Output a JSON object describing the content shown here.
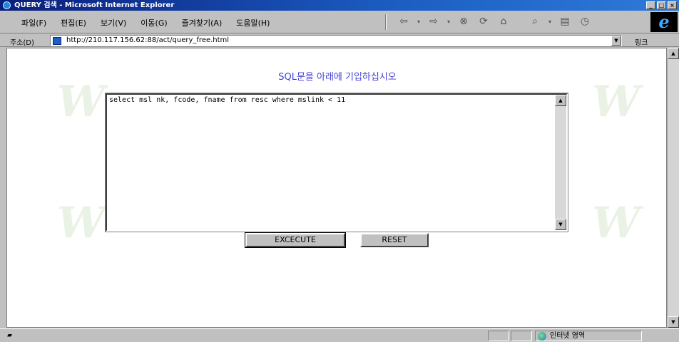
{
  "window": {
    "title": "QUERY 검색 - Microsoft Internet Explorer",
    "controls": [
      "_",
      "□",
      "×"
    ]
  },
  "menu": {
    "items": [
      "파일(F)",
      "편집(E)",
      "보기(V)",
      "이동(G)",
      "즐겨찾기(A)",
      "도움말(H)"
    ]
  },
  "toolbar": {
    "icons": [
      "back-icon",
      "forward-icon",
      "stop-icon",
      "refresh-icon",
      "home-icon",
      "search-icon",
      "favorites-icon",
      "history-icon"
    ]
  },
  "address": {
    "label": "주소(D)",
    "url": "http://210.117.156.62:88/act/query_free.html",
    "links_label": "링크"
  },
  "page": {
    "heading": "SQL문을 아래에 기입하십시오",
    "query_text": "select msl nk, fcode, fname from resc where mslink < 11",
    "execute_label": "EXCECUTE",
    "reset_label": "RESET"
  },
  "status": {
    "zone_label": "인터넷 영역"
  }
}
